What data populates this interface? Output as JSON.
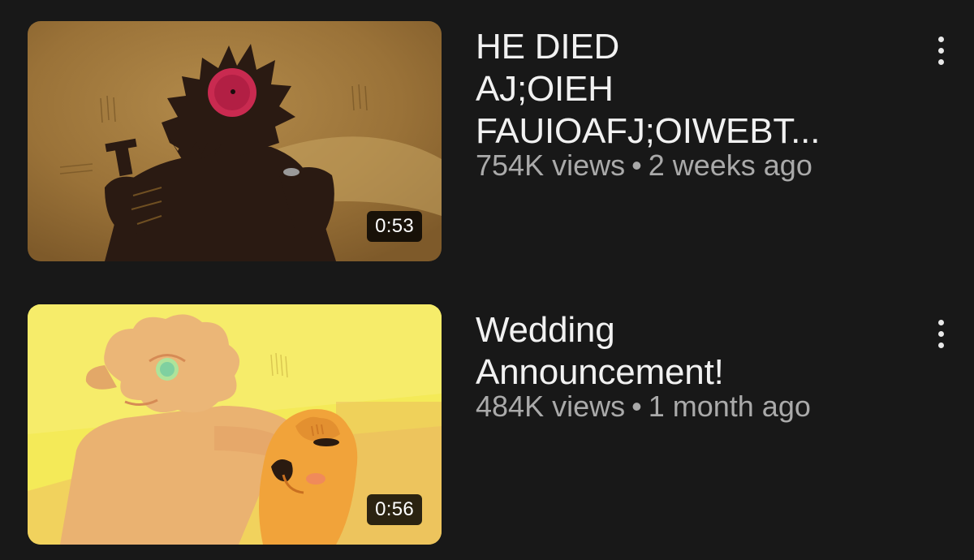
{
  "videos": [
    {
      "title": "HE DIED\nAJ;OIEH\nFAUIOAFJ;OIWEBT...",
      "views": "754K views",
      "separator": "•",
      "age": "2 weeks ago",
      "duration": "0:53",
      "menu_icon": "more-vert-icon"
    },
    {
      "title": "Wedding\nAnnouncement!",
      "views": "484K views",
      "separator": "•",
      "age": "1 month ago",
      "duration": "0:56",
      "menu_icon": "more-vert-icon"
    }
  ],
  "colors": {
    "background": "#181818",
    "title": "#f1f1f1",
    "meta": "#aaaaaa"
  }
}
